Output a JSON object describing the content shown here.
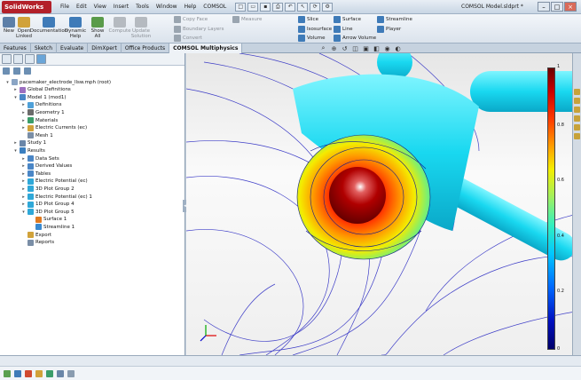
{
  "app": {
    "logo": "SolidWorks",
    "window_title": "COMSOL Model.sldprt *"
  },
  "menu": [
    "File",
    "Edit",
    "View",
    "Insert",
    "Tools",
    "Window",
    "Help",
    "COMSOL"
  ],
  "ribbon": {
    "buttons": [
      {
        "label": "New",
        "color": "#5c7fa8"
      },
      {
        "label": "Open Linked",
        "color": "#d1a23a"
      },
      {
        "label": "Documentation",
        "color": "#3f7bb8"
      },
      {
        "label": "Dynamic Help",
        "color": "#3f7bb8"
      },
      {
        "label": "Show All",
        "color": "#5a9b4a"
      },
      {
        "label": "Compute",
        "color": "#8a8f96"
      },
      {
        "label": "Update Solution",
        "color": "#8a8f96"
      }
    ],
    "small1": [
      "Copy Face",
      "Boundary Layers",
      "Convert"
    ],
    "small_measure": "Measure",
    "small2": [
      "Slice",
      "Isosurface",
      "Volume"
    ],
    "small3": [
      "Surface",
      "Line",
      "Arrow Volume"
    ],
    "small4": [
      "Streamline",
      "Player"
    ]
  },
  "tabs": [
    "Features",
    "Sketch",
    "Evaluate",
    "DimXpert",
    "Office Products",
    "COMSOL Multiphysics"
  ],
  "tree": [
    {
      "label": "pacemaker_electrode_llsw.mph (root)",
      "level": 0,
      "exp": "▾",
      "icon": "#8aa4c4"
    },
    {
      "label": "Global Definitions",
      "level": 1,
      "exp": "▸",
      "icon": "#9c6fc0"
    },
    {
      "label": "Model 1 (mod1)",
      "level": 1,
      "exp": "▾",
      "icon": "#4a86c6"
    },
    {
      "label": "Definitions",
      "level": 2,
      "exp": "▸",
      "icon": "#4fa0d8"
    },
    {
      "label": "Geometry 1",
      "level": 2,
      "exp": "▸",
      "icon": "#6b6b6b"
    },
    {
      "label": "Materials",
      "level": 2,
      "exp": "▸",
      "icon": "#3b9d6a"
    },
    {
      "label": "Electric Currents (ec)",
      "level": 2,
      "exp": "▸",
      "icon": "#d1a23a"
    },
    {
      "label": "Mesh 1",
      "level": 2,
      "exp": "",
      "icon": "#7a8ea6"
    },
    {
      "label": "Study 1",
      "level": 1,
      "exp": "▸",
      "icon": "#6a86a8"
    },
    {
      "label": "Results",
      "level": 1,
      "exp": "▾",
      "icon": "#3b7fc0"
    },
    {
      "label": "Data Sets",
      "level": 2,
      "exp": "▸",
      "icon": "#4a86c6"
    },
    {
      "label": "Derived Values",
      "level": 2,
      "exp": "▸",
      "icon": "#4a86c6"
    },
    {
      "label": "Tables",
      "level": 2,
      "exp": "▸",
      "icon": "#4a86c6"
    },
    {
      "label": "Electric Potential (ec)",
      "level": 2,
      "exp": "▸",
      "icon": "#2fa8d8"
    },
    {
      "label": "3D Plot Group 2",
      "level": 2,
      "exp": "▸",
      "icon": "#2fa8d8"
    },
    {
      "label": "Electric Potential (ec) 1",
      "level": 2,
      "exp": "▸",
      "icon": "#2fa8d8"
    },
    {
      "label": "1D Plot Group 4",
      "level": 2,
      "exp": "▸",
      "icon": "#2fa8d8"
    },
    {
      "label": "3D Plot Group 5",
      "level": 2,
      "exp": "▾",
      "icon": "#2fa8d8"
    },
    {
      "label": "Surface 1",
      "level": 3,
      "exp": "",
      "icon": "#e07a20"
    },
    {
      "label": "Streamline 1",
      "level": 3,
      "exp": "",
      "icon": "#3a8ad0"
    },
    {
      "label": "Export",
      "level": 2,
      "exp": "",
      "icon": "#d1a23a"
    },
    {
      "label": "Reports",
      "level": 2,
      "exp": "",
      "icon": "#7a8ea6"
    }
  ],
  "colorbar": {
    "max": "1",
    "min": "0",
    "ticks": [
      "0.8",
      "0.6",
      "0.4",
      "0.2"
    ]
  }
}
